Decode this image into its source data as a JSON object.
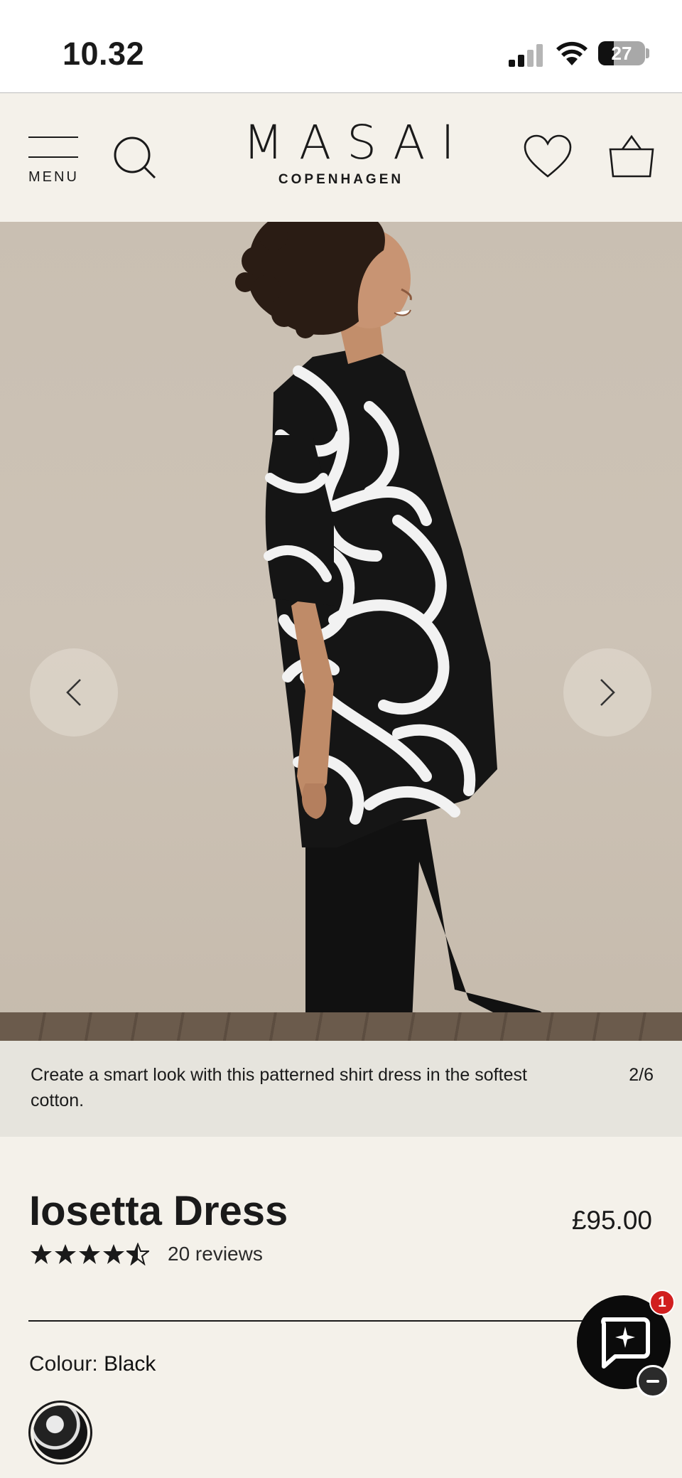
{
  "status_bar": {
    "time": "10.32",
    "battery": "27"
  },
  "header": {
    "menu_label": "MENU",
    "logo_main": "MASAI",
    "logo_sub": "COPENHAGEN"
  },
  "gallery": {
    "caption": "Create a smart look with this patterned shirt dress in the softest cotton.",
    "counter": "2/6",
    "current_image": 2,
    "total_images": 6
  },
  "product": {
    "title": "Iosetta Dress",
    "price": "£95.00",
    "rating": 4.5,
    "reviews": "20 reviews",
    "colour_label": "Colour:",
    "colour_value": "Black"
  },
  "chat": {
    "badge_count": "1"
  },
  "colors": {
    "page_background": "#f4f1ea",
    "caption_background": "#e6e4dd",
    "badge": "#d11f1f",
    "text": "#1a1a1a"
  }
}
